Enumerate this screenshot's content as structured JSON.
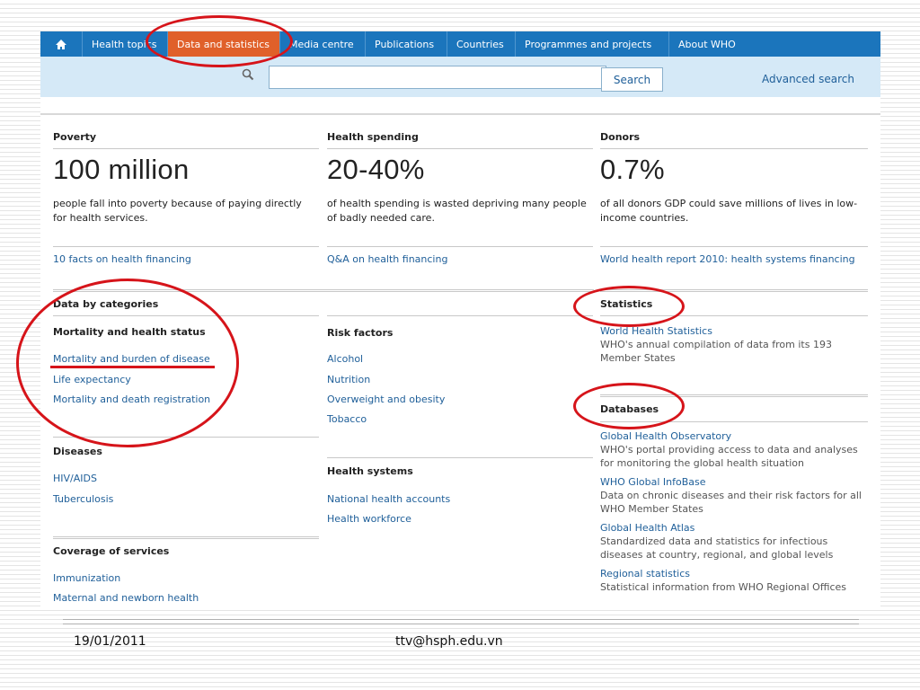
{
  "nav": {
    "items": [
      {
        "label": "Health topics"
      },
      {
        "label": "Data and statistics"
      },
      {
        "label": "Media centre"
      },
      {
        "label": "Publications"
      },
      {
        "label": "Countries"
      },
      {
        "label": "Programmes and projects"
      },
      {
        "label": "About WHO"
      }
    ],
    "active_item": "Data and statistics",
    "icons": {
      "home": "home-icon",
      "search": "search-icon"
    }
  },
  "search": {
    "value": "",
    "button_label": "Search",
    "advanced_label": "Advanced search"
  },
  "stats": [
    {
      "title": "Poverty",
      "big_number": "100 million",
      "description": "people fall into poverty because of paying directly for health services.",
      "link": "10 facts on health financing"
    },
    {
      "title": "Health spending",
      "big_number": "20-40%",
      "description": "of health spending is wasted depriving many people of badly needed care.",
      "link": "Q&A on health financing"
    },
    {
      "title": "Donors",
      "big_number": "0.7%",
      "description": "of all donors GDP could save millions of lives in low-income countries.",
      "link": "World health report 2010: health systems financing"
    }
  ],
  "categories": {
    "title": "Data by categories",
    "mortality": {
      "title": "Mortality and health status",
      "links": [
        "Mortality and burden of disease",
        "Life expectancy",
        "Mortality and death registration"
      ]
    },
    "risk": {
      "title": "Risk factors",
      "links": [
        "Alcohol",
        "Nutrition",
        "Overweight and obesity",
        "Tobacco"
      ]
    },
    "diseases": {
      "title": "Diseases",
      "links": [
        "HIV/AIDS",
        "Tuberculosis"
      ]
    },
    "systems": {
      "title": "Health systems",
      "links": [
        "National health accounts",
        "Health workforce"
      ]
    },
    "coverage": {
      "title": "Coverage of services",
      "links": [
        "Immunization",
        "Maternal and newborn health"
      ]
    }
  },
  "statistics": {
    "title": "Statistics",
    "items": [
      {
        "link": "World Health Statistics",
        "text": "WHO's annual compilation of data from its 193 Member States"
      }
    ]
  },
  "databases": {
    "title": "Databases",
    "items": [
      {
        "link": "Global Health Observatory",
        "text": "WHO's portal providing access to data and analyses for monitoring the global health situation"
      },
      {
        "link": "WHO Global InfoBase",
        "text": "Data on chronic diseases and their risk factors for all WHO Member States"
      },
      {
        "link": "Global Health Atlas",
        "text": "Standardized data and statistics for infectious diseases at country, regional, and global levels"
      },
      {
        "link": "Regional statistics",
        "text": "Statistical information from WHO Regional Offices"
      }
    ]
  },
  "footer": {
    "date": "19/01/2011",
    "email": "ttv@hsph.edu.vn"
  },
  "annotation_color": "#d6141a",
  "nav_color": "#1b75bc",
  "active_tab_color": "#e0602a"
}
